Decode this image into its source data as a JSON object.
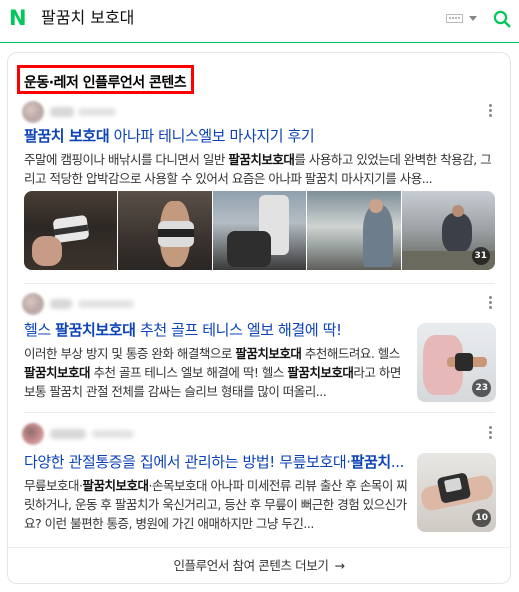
{
  "header": {
    "logo": "N",
    "query": "팔꿈치 보호대",
    "brand_color": "#03c75a"
  },
  "section": {
    "title": "운동·레저 인플루언서 콘텐츠"
  },
  "items": [
    {
      "title_parts": [
        "팔꿈치 보호대",
        " 아나파 테니스엘보 마사지기 후기"
      ],
      "desc_html": "주말에 캠핑이나 배낚시를 다니면서 일반 <b>팔꿈치보호대</b>를 사용하고 있었는데 완벽한 착용감, 그리고 적당한 압박감으로 사용할 수 있어서 요즘은 아나파 팔꿈치 마사지기를 사용...",
      "photo_count": "31"
    },
    {
      "title_parts": [
        "헬스 ",
        "팔꿈치보호대",
        " 추천 골프 테니스 엘보 해결에 딱!"
      ],
      "desc_html": "이러한 부상 방지 및 통증 완화 해결책으로 <b>팔꿈치보호대</b> 추천해드려요. 헬스 <b>팔꿈치보호대</b> 추천 골프 테니스 엘보 해결에 딱! 헬스 <b>팔꿈치보호대</b>라고 하면 보통 팔꿈치 관절 전체를 감싸는 슬리브 형태를 많이 떠올리...",
      "photo_count": "23"
    },
    {
      "title_parts": [
        "다양한 관절통증을 집에서 관리하는 방법! 무릎보호대·",
        "팔꿈치",
        "..."
      ],
      "desc_html": "무릎보호대·<b>팔꿈치보호대</b>·손목보호대 아나파 미세전류 리뷰 출산 후 손목이 찌릿하거나, 운동 후 팔꿈치가 욱신거리고, 등산 후 무릎이 뻐근한 경험 있으신가요? 이런 불편한 통증, 병원에 가긴 애매하지만 그냥 두긴...",
      "photo_count": "10"
    }
  ],
  "footer": {
    "more_label": "인플루언서 참여 콘텐츠 더보기",
    "arrow": "→"
  }
}
